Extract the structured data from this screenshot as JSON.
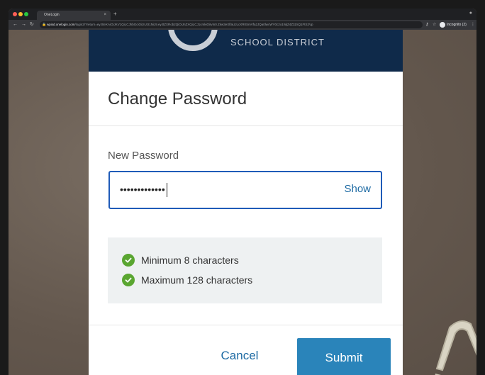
{
  "browser": {
    "tab_title": "OneLogin",
    "tab_close": "×",
    "new_tab": "+",
    "url_host": "wpisd.onelogin.com",
    "url_rest": "/login2/?return=eyJ0eXAiOiJKV1QiLCJhbGciOiJIUzI1NiJ9.eyJtZXRob2QiOiJnZXQiLCJ1cmkiOiIvIn0.Zkw3eXlfaUJLcXR0SmVfa2JQa0lwcWY0c2o1WjZ4Z3ZsQ1FtS2Vp",
    "incognito_label": "Incognito (2)"
  },
  "modal": {
    "district_name": "SCHOOL DISTRICT",
    "title": "Change Password",
    "field_label": "New Password",
    "password_masked": "•••••••••••••",
    "show_label": "Show",
    "requirements": [
      {
        "text": "Minimum 8 characters"
      },
      {
        "text": "Maximum 128 characters"
      }
    ],
    "cancel_label": "Cancel",
    "submit_label": "Submit"
  },
  "colors": {
    "header_navy": "#0f2a4a",
    "accent_blue": "#1d6aa3",
    "submit_blue": "#2a84ba",
    "check_green": "#5aa631",
    "focus_border": "#1f5bb8"
  }
}
